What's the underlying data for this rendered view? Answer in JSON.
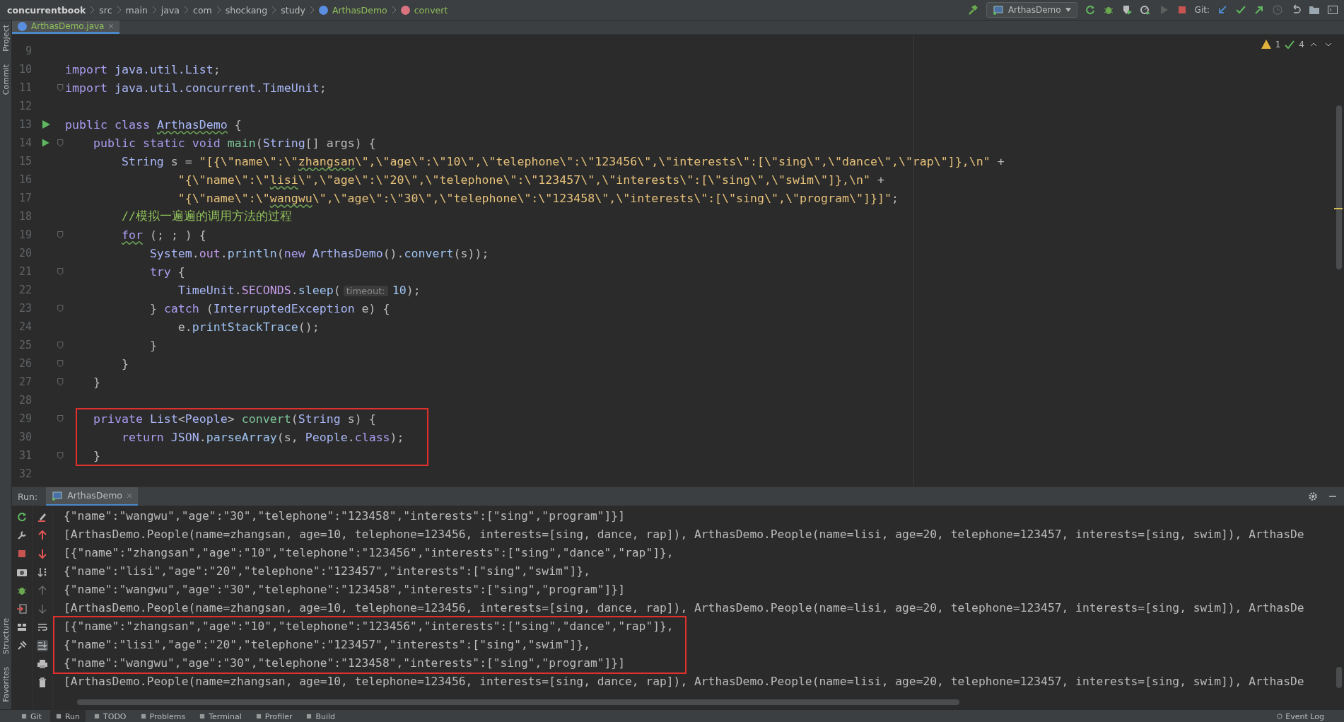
{
  "breadcrumbs": [
    {
      "kind": "project",
      "label": "concurrentbook"
    },
    {
      "kind": "folder",
      "label": "src"
    },
    {
      "kind": "folder",
      "label": "main"
    },
    {
      "kind": "folder",
      "label": "java"
    },
    {
      "kind": "folder",
      "label": "com"
    },
    {
      "kind": "folder",
      "label": "shockang"
    },
    {
      "kind": "folder",
      "label": "study"
    },
    {
      "kind": "class",
      "label": "ArthasDemo"
    },
    {
      "kind": "method",
      "label": "convert"
    }
  ],
  "toolbar": {
    "run_config": "ArthasDemo",
    "git_label": "Git:"
  },
  "editor_tabs": [
    {
      "label": "ArthasDemo.java",
      "selected": true
    }
  ],
  "inspections": {
    "warnings": "1",
    "checks": "4"
  },
  "side_labels_top": [
    "Project",
    "Commit"
  ],
  "side_labels_bottom": [
    "Structure",
    "Favorites"
  ],
  "code_lines": [
    {
      "number": "9",
      "kind": "plain",
      "boxed": false
    },
    {
      "number": "10",
      "kind": "plain",
      "boxed": false,
      "tokens": [
        {
          "kind": "keyword",
          "text": "import "
        },
        {
          "kind": "type",
          "text": "java.util.List"
        },
        {
          "kind": "plain",
          "text": ";"
        }
      ]
    },
    {
      "number": "11",
      "kind": "fold",
      "boxed": false,
      "tokens": [
        {
          "kind": "keyword",
          "text": "import "
        },
        {
          "kind": "type",
          "text": "java.util.concurrent.TimeUnit"
        },
        {
          "kind": "plain",
          "text": ";"
        }
      ]
    },
    {
      "number": "12",
      "kind": "plain",
      "boxed": false
    },
    {
      "number": "13",
      "kind": "run",
      "boxed": false,
      "tokens": [
        {
          "kind": "keyword",
          "text": "public class "
        },
        {
          "kind": "class_typo",
          "text": "ArthasDemo"
        },
        {
          "kind": "plain",
          "text": " {"
        }
      ]
    },
    {
      "number": "14",
      "kind": "run-fold",
      "boxed": false,
      "tokens": [
        {
          "kind": "keyword",
          "text": "    public static void "
        },
        {
          "kind": "declaration",
          "text": "main"
        },
        {
          "kind": "plain",
          "text": "("
        },
        {
          "kind": "type",
          "text": "String"
        },
        {
          "kind": "plain",
          "text": "[] args) {"
        }
      ]
    },
    {
      "number": "15",
      "kind": "plain",
      "boxed": false,
      "tokens": [
        {
          "kind": "type",
          "text": "        String"
        },
        {
          "kind": "plain",
          "text": " s = "
        },
        {
          "kind": "string",
          "text": "\"[{\\\"name\\\":\\\""
        },
        {
          "kind": "string_typo",
          "text": "zhangsan"
        },
        {
          "kind": "string",
          "text": "\\\",\\\"age\\\":\\\"10\\\",\\\"telephone\\\":\\\"123456\\\",\\\"interests\\\":[\\\"sing\\\",\\\"dance\\\",\\\"rap\\\"]},\\n\""
        },
        {
          "kind": "plain",
          "text": " +"
        }
      ]
    },
    {
      "number": "16",
      "kind": "plain",
      "boxed": false,
      "tokens": [
        {
          "kind": "string",
          "text": "                \"{\\\"name\\\":\\\""
        },
        {
          "kind": "string_typo",
          "text": "lisi"
        },
        {
          "kind": "string",
          "text": "\\\",\\\"age\\\":\\\"20\\\",\\\"telephone\\\":\\\"123457\\\",\\\"interests\\\":[\\\"sing\\\",\\\"swim\\\"]},\\n\""
        },
        {
          "kind": "plain",
          "text": " +"
        }
      ]
    },
    {
      "number": "17",
      "kind": "plain",
      "boxed": false,
      "tokens": [
        {
          "kind": "string",
          "text": "                \"{\\\"name\\\":\\\""
        },
        {
          "kind": "string_typo",
          "text": "wangwu"
        },
        {
          "kind": "string",
          "text": "\\\",\\\"age\\\":\\\"30\\\",\\\"telephone\\\":\\\"123458\\\",\\\"interests\\\":[\\\"sing\\\",\\\"program\\\"]}]\""
        },
        {
          "kind": "plain",
          "text": ";"
        }
      ]
    },
    {
      "number": "18",
      "kind": "plain",
      "boxed": false,
      "tokens": [
        {
          "kind": "comment",
          "text": "        //模拟一遍遍的调用方法的过程"
        }
      ]
    },
    {
      "number": "19",
      "kind": "fold",
      "boxed": false,
      "tokens": [
        {
          "kind": "keyword_typo",
          "text": "        for"
        },
        {
          "kind": "plain",
          "text": " (; ; ) {"
        }
      ]
    },
    {
      "number": "20",
      "kind": "plain",
      "boxed": false,
      "tokens": [
        {
          "kind": "type",
          "text": "            System"
        },
        {
          "kind": "plain",
          "text": "."
        },
        {
          "kind": "field",
          "text": "out"
        },
        {
          "kind": "plain",
          "text": "."
        },
        {
          "kind": "method",
          "text": "println"
        },
        {
          "kind": "plain",
          "text": "("
        },
        {
          "kind": "keyword",
          "text": "new "
        },
        {
          "kind": "type",
          "text": "ArthasDemo"
        },
        {
          "kind": "plain",
          "text": "()."
        },
        {
          "kind": "method",
          "text": "convert"
        },
        {
          "kind": "plain",
          "text": "(s));"
        }
      ]
    },
    {
      "number": "21",
      "kind": "fold",
      "boxed": false,
      "tokens": [
        {
          "kind": "keyword",
          "text": "            try"
        },
        {
          "kind": "plain",
          "text": " {"
        }
      ]
    },
    {
      "number": "22",
      "kind": "plain",
      "boxed": false,
      "tokens": [
        {
          "kind": "type",
          "text": "                TimeUnit"
        },
        {
          "kind": "plain",
          "text": "."
        },
        {
          "kind": "field",
          "text": "SECONDS"
        },
        {
          "kind": "plain",
          "text": "."
        },
        {
          "kind": "method",
          "text": "sleep"
        },
        {
          "kind": "plain",
          "text": "("
        },
        {
          "kind": "hint",
          "text": "timeout:"
        },
        {
          "kind": "number",
          "text": "10"
        },
        {
          "kind": "plain",
          "text": ");"
        }
      ]
    },
    {
      "number": "23",
      "kind": "fold",
      "boxed": false,
      "tokens": [
        {
          "kind": "plain",
          "text": "            } "
        },
        {
          "kind": "keyword",
          "text": "catch"
        },
        {
          "kind": "plain",
          "text": " ("
        },
        {
          "kind": "type",
          "text": "InterruptedException"
        },
        {
          "kind": "plain",
          "text": " e) {"
        }
      ]
    },
    {
      "number": "24",
      "kind": "plain",
      "boxed": false,
      "tokens": [
        {
          "kind": "plain",
          "text": "                e."
        },
        {
          "kind": "method",
          "text": "printStackTrace"
        },
        {
          "kind": "plain",
          "text": "();"
        }
      ]
    },
    {
      "number": "25",
      "kind": "fold",
      "boxed": false,
      "tokens": [
        {
          "kind": "plain",
          "text": "            }"
        }
      ]
    },
    {
      "number": "26",
      "kind": "fold",
      "boxed": false,
      "tokens": [
        {
          "kind": "plain",
          "text": "        }"
        }
      ]
    },
    {
      "number": "27",
      "kind": "fold",
      "boxed": false,
      "tokens": [
        {
          "kind": "plain",
          "text": "    }"
        }
      ]
    },
    {
      "number": "28",
      "kind": "plain",
      "boxed": false
    },
    {
      "number": "29",
      "kind": "fold",
      "boxed": true,
      "tokens": [
        {
          "kind": "keyword",
          "text": "    private "
        },
        {
          "kind": "type",
          "text": "List"
        },
        {
          "kind": "plain",
          "text": "<"
        },
        {
          "kind": "type",
          "text": "People"
        },
        {
          "kind": "plain",
          "text": "> "
        },
        {
          "kind": "declaration",
          "text": "convert"
        },
        {
          "kind": "plain",
          "text": "("
        },
        {
          "kind": "type",
          "text": "String"
        },
        {
          "kind": "plain",
          "text": " s) {"
        }
      ]
    },
    {
      "number": "30",
      "kind": "plain",
      "boxed": true,
      "tokens": [
        {
          "kind": "keyword",
          "text": "        return "
        },
        {
          "kind": "type",
          "text": "JSON"
        },
        {
          "kind": "plain",
          "text": "."
        },
        {
          "kind": "method",
          "text": "parseArray"
        },
        {
          "kind": "plain",
          "text": "(s, "
        },
        {
          "kind": "type",
          "text": "People"
        },
        {
          "kind": "plain",
          "text": "."
        },
        {
          "kind": "keyword",
          "text": "class"
        },
        {
          "kind": "plain",
          "text": ");"
        }
      ]
    },
    {
      "number": "31",
      "kind": "fold",
      "boxed": true,
      "tokens": [
        {
          "kind": "plain",
          "text": "    }"
        }
      ]
    },
    {
      "number": "32",
      "kind": "plain",
      "boxed": false
    }
  ],
  "run_panel": {
    "label": "Run:",
    "tab": "ArthasDemo"
  },
  "console_lines": [
    {
      "boxed": false,
      "text": "{\"name\":\"wangwu\",\"age\":\"30\",\"telephone\":\"123458\",\"interests\":[\"sing\",\"program\"]}]"
    },
    {
      "boxed": false,
      "text": "[ArthasDemo.People(name=zhangsan, age=10, telephone=123456, interests=[sing, dance, rap]), ArthasDemo.People(name=lisi, age=20, telephone=123457, interests=[sing, swim]), ArthasDe"
    },
    {
      "boxed": false,
      "text": "[{\"name\":\"zhangsan\",\"age\":\"10\",\"telephone\":\"123456\",\"interests\":[\"sing\",\"dance\",\"rap\"]},"
    },
    {
      "boxed": false,
      "text": "{\"name\":\"lisi\",\"age\":\"20\",\"telephone\":\"123457\",\"interests\":[\"sing\",\"swim\"]},"
    },
    {
      "boxed": false,
      "text": "{\"name\":\"wangwu\",\"age\":\"30\",\"telephone\":\"123458\",\"interests\":[\"sing\",\"program\"]}]"
    },
    {
      "boxed": false,
      "text": "[ArthasDemo.People(name=zhangsan, age=10, telephone=123456, interests=[sing, dance, rap]), ArthasDemo.People(name=lisi, age=20, telephone=123457, interests=[sing, swim]), ArthasDe"
    },
    {
      "boxed": true,
      "text": "[{\"name\":\"zhangsan\",\"age\":\"10\",\"telephone\":\"123456\",\"interests\":[\"sing\",\"dance\",\"rap\"]},"
    },
    {
      "boxed": true,
      "text": "{\"name\":\"lisi\",\"age\":\"20\",\"telephone\":\"123457\",\"interests\":[\"sing\",\"swim\"]},"
    },
    {
      "boxed": true,
      "text": "{\"name\":\"wangwu\",\"age\":\"30\",\"telephone\":\"123458\",\"interests\":[\"sing\",\"program\"]}]"
    },
    {
      "boxed": false,
      "text": "[ArthasDemo.People(name=zhangsan, age=10, telephone=123456, interests=[sing, dance, rap]), ArthasDemo.People(name=lisi, age=20, telephone=123457, interests=[sing, swim]), ArthasDe"
    }
  ],
  "bottom_tools": [
    {
      "label": "Git",
      "selected": false
    },
    {
      "label": "Run",
      "selected": true
    },
    {
      "label": "TODO",
      "selected": false
    },
    {
      "label": "Problems",
      "selected": false
    },
    {
      "label": "Terminal",
      "selected": false
    },
    {
      "label": "Profiler",
      "selected": false
    },
    {
      "label": "Build",
      "selected": false
    }
  ],
  "event_log": "Event Log"
}
